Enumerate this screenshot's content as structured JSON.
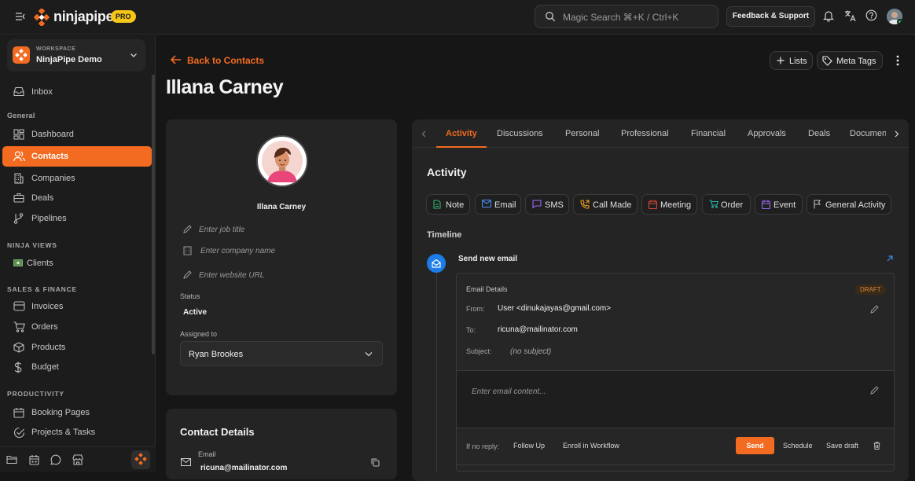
{
  "brand": {
    "name": "ninjapipe",
    "badge": "PRO",
    "accent": "#f36a21"
  },
  "topbar": {
    "search_placeholder": "Magic Search ⌘+K / Ctrl+K",
    "feedback_label": "Feedback & Support"
  },
  "workspace": {
    "caption": "WORKSPACE",
    "name": "NinjaPipe Demo"
  },
  "sidebar": {
    "inbox": "Inbox",
    "general_title": "General",
    "dashboard": "Dashboard",
    "contacts": "Contacts",
    "companies": "Companies",
    "deals": "Deals",
    "pipelines": "Pipelines",
    "ninja_views_title": "NINJA VIEWS",
    "clients": "Clients",
    "sales_title": "SALES & FINANCE",
    "invoices": "Invoices",
    "orders": "Orders",
    "products": "Products",
    "budget": "Budget",
    "productivity_title": "PRODUCTIVITY",
    "booking": "Booking Pages",
    "projects": "Projects & Tasks"
  },
  "header": {
    "back_label": "Back to Contacts",
    "title": "Illana Carney",
    "lists_label": "Lists",
    "meta_tags_label": "Meta Tags"
  },
  "profile": {
    "name": "Illana Carney",
    "job_placeholder": "Enter job title",
    "company_placeholder": "Enter company name",
    "website_placeholder": "Enter website URL",
    "status_label": "Status",
    "status_value": "Active",
    "assigned_label": "Assigned to",
    "assigned_value": "Ryan Brookes"
  },
  "contact_details": {
    "title": "Contact Details",
    "email_label": "Email",
    "email_value": "ricuna@mailinator.com"
  },
  "tabs": [
    "Activity",
    "Discussions",
    "Personal",
    "Professional",
    "Financial",
    "Approvals",
    "Deals",
    "Documen"
  ],
  "activity": {
    "title": "Activity",
    "chips": [
      "Note",
      "Email",
      "SMS",
      "Call Made",
      "Meeting",
      "Order",
      "Event",
      "General Activity"
    ],
    "chip_colors": [
      "#2fb56a",
      "#4a8ef0",
      "#9b6bf0",
      "#f0a020",
      "#e0453a",
      "#23b8a8",
      "#9b6bf0",
      "#bdbdbd"
    ],
    "timeline_label": "Timeline",
    "entry_title": "Send new email"
  },
  "email": {
    "section_title": "Email Details",
    "status_badge": "DRAFT",
    "from_label": "From:",
    "from_value": "User <dinukajayas@gmail.com>",
    "to_label": "To:",
    "to_value": "ricuna@mailinator.com",
    "subject_label": "Subject:",
    "subject_value": "(no subject)",
    "content_placeholder": "Enter email content...",
    "no_reply_label": "If no reply:",
    "follow_up": "Follow Up",
    "enroll": "Enroll in Workflow",
    "send": "Send",
    "schedule": "Schedule",
    "save_draft": "Save draft"
  }
}
